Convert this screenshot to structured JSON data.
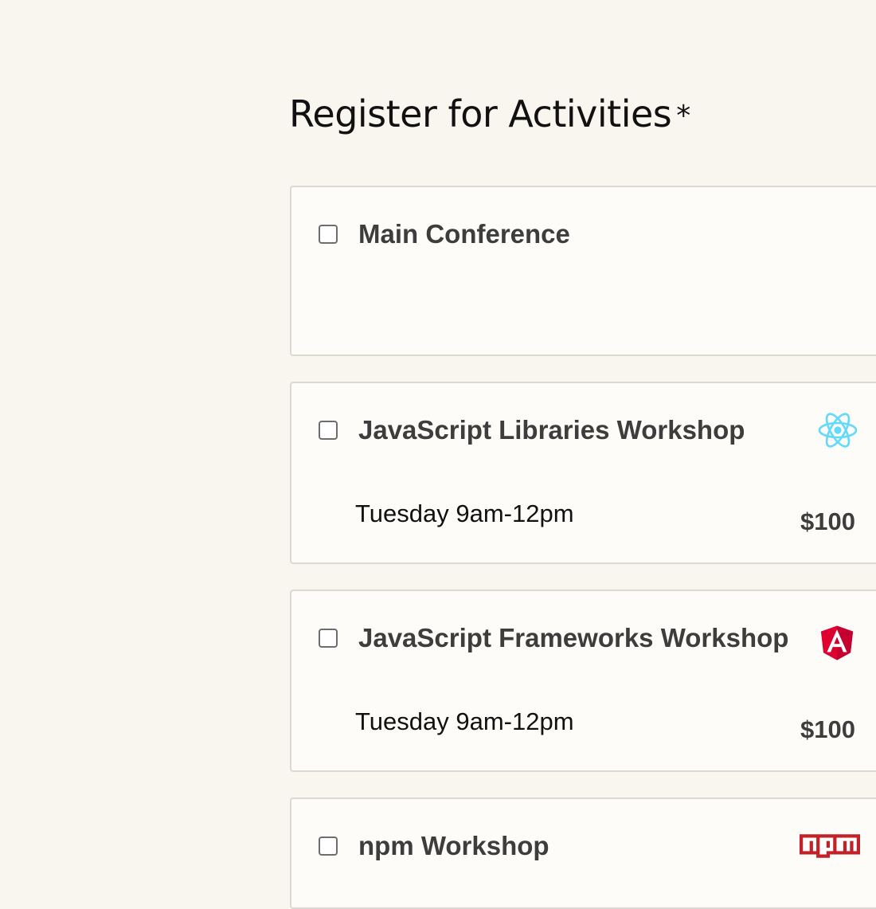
{
  "section": {
    "title": "Register for Activities",
    "required_marker": "*"
  },
  "activities": [
    {
      "name": "Main Conference",
      "checked": false
    },
    {
      "name": "JavaScript Libraries Workshop",
      "time": "Tuesday 9am-12pm",
      "cost": "$100",
      "icon": "react-logo-icon",
      "checked": false
    },
    {
      "name": "JavaScript Frameworks Workshop",
      "time": "Tuesday 9am-12pm",
      "cost": "$100",
      "icon": "angular-logo-icon",
      "checked": false
    },
    {
      "name": "npm Workshop",
      "icon": "npm-logo-icon",
      "icon_text": "npm",
      "checked": false
    }
  ],
  "colors": {
    "page_background": "#f9f5ef",
    "card_background": "#fdfcf9",
    "card_border": "#dcd9d3",
    "react_cyan": "#61dafb",
    "angular_red": "#dd0031",
    "npm_red": "#c12127"
  }
}
